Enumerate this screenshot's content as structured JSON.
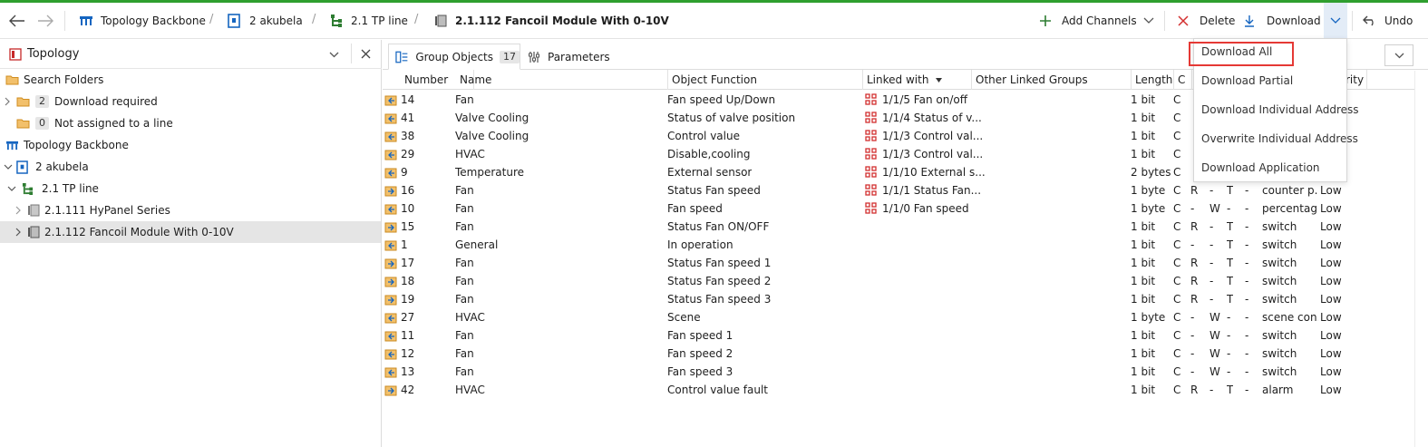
{
  "toolbar": {
    "breadcrumb": [
      {
        "label": "Topology Backbone",
        "icon": "topology-icon"
      },
      {
        "label": "2 akubela",
        "icon": "area-icon"
      },
      {
        "label": "2.1 TP line",
        "icon": "line-icon"
      },
      {
        "label": "2.1.112 Fancoil Module With 0-10V",
        "icon": "device-icon"
      }
    ],
    "add_channels": "Add Channels",
    "delete": "Delete",
    "download": "Download",
    "undo": "Undo"
  },
  "left_panel": {
    "title": "Topology",
    "tree": [
      {
        "label": "Search Folders",
        "icon": "folder-icon",
        "level": 0,
        "bold": false
      },
      {
        "label": "Download required",
        "badge": "2",
        "icon": "folder-icon",
        "level": 1,
        "expander": true
      },
      {
        "label": "Not assigned to a line",
        "badge": "0",
        "icon": "folder-icon",
        "level": 1
      },
      {
        "label": "Topology Backbone",
        "icon": "topology-icon",
        "level": 0
      },
      {
        "label": "2 akubela",
        "icon": "area-icon",
        "level": 1,
        "expanded": true
      },
      {
        "label": "2.1 TP line",
        "icon": "line-icon",
        "level": 2,
        "expanded": true
      },
      {
        "label": "2.1.111 HyPanel Series",
        "icon": "device-icon",
        "level": 3
      },
      {
        "label": "2.1.112 Fancoil Module With 0-10V",
        "icon": "device-icon",
        "level": 3,
        "selected": true
      }
    ]
  },
  "tabs": [
    {
      "label": "Group Objects",
      "count": "17",
      "active": true
    },
    {
      "label": "Parameters",
      "active": false
    }
  ],
  "table": {
    "columns": [
      "Number",
      "Name",
      "Object Function",
      "Linked with",
      "Other Linked Groups",
      "Length",
      "C",
      "",
      "",
      "",
      "",
      "",
      "rity"
    ],
    "rows": [
      {
        "num": "14",
        "name": "Fan",
        "func": "Fan speed Up/Down",
        "linked": "1/1/5 Fan on/off",
        "length": "1 bit",
        "c": "C",
        "r": "",
        "w": "",
        "t": "",
        "u": "",
        "dpt": "",
        "prio": ""
      },
      {
        "num": "41",
        "name": "Valve Cooling",
        "func": "Status of valve position",
        "linked": "1/1/4 Status of v...",
        "length": "1 bit",
        "c": "C",
        "r": "",
        "w": "",
        "t": "",
        "u": "",
        "dpt": "",
        "prio": ""
      },
      {
        "num": "38",
        "name": "Valve Cooling",
        "func": "Control value",
        "linked": "1/1/3 Control val...",
        "length": "1 bit",
        "c": "C",
        "r": "",
        "w": "",
        "t": "",
        "u": "",
        "dpt": "",
        "prio": ""
      },
      {
        "num": "29",
        "name": "HVAC",
        "func": "Disable,cooling",
        "linked": "1/1/3 Control val...",
        "length": "1 bit",
        "c": "C",
        "r": "",
        "w": "",
        "t": "",
        "u": "",
        "dpt": "",
        "prio": ""
      },
      {
        "num": "9",
        "name": "Temperature",
        "func": "External sensor",
        "linked": "1/1/10 External s...",
        "length": "2 bytes",
        "c": "C",
        "r": "",
        "w": "",
        "t": "",
        "u": "",
        "dpt": "",
        "prio": ""
      },
      {
        "num": "16",
        "name": "Fan",
        "func": "Status Fan speed",
        "linked": "1/1/1 Status Fan...",
        "length": "1 byte",
        "c": "C",
        "r": "R",
        "w": "-",
        "t": "T",
        "u": "-",
        "dpt": "counter p...",
        "prio": "Low"
      },
      {
        "num": "10",
        "name": "Fan",
        "func": "Fan speed",
        "linked": "1/1/0 Fan speed",
        "length": "1 byte",
        "c": "C",
        "r": "-",
        "w": "W",
        "t": "-",
        "u": "-",
        "dpt": "percentag...",
        "prio": "Low"
      },
      {
        "num": "15",
        "name": "Fan",
        "func": "Status Fan ON/OFF",
        "linked": "",
        "length": "1 bit",
        "c": "C",
        "r": "R",
        "w": "-",
        "t": "T",
        "u": "-",
        "dpt": "switch",
        "prio": "Low"
      },
      {
        "num": "1",
        "name": "General",
        "func": "In operation",
        "linked": "",
        "length": "1 bit",
        "c": "C",
        "r": "-",
        "w": "-",
        "t": "T",
        "u": "-",
        "dpt": "switch",
        "prio": "Low"
      },
      {
        "num": "17",
        "name": "Fan",
        "func": "Status Fan speed 1",
        "linked": "",
        "length": "1 bit",
        "c": "C",
        "r": "R",
        "w": "-",
        "t": "T",
        "u": "-",
        "dpt": "switch",
        "prio": "Low"
      },
      {
        "num": "18",
        "name": "Fan",
        "func": "Status Fan speed 2",
        "linked": "",
        "length": "1 bit",
        "c": "C",
        "r": "R",
        "w": "-",
        "t": "T",
        "u": "-",
        "dpt": "switch",
        "prio": "Low"
      },
      {
        "num": "19",
        "name": "Fan",
        "func": "Status Fan speed 3",
        "linked": "",
        "length": "1 bit",
        "c": "C",
        "r": "R",
        "w": "-",
        "t": "T",
        "u": "-",
        "dpt": "switch",
        "prio": "Low"
      },
      {
        "num": "27",
        "name": "HVAC",
        "func": "Scene",
        "linked": "",
        "length": "1 byte",
        "c": "C",
        "r": "-",
        "w": "W",
        "t": "-",
        "u": "-",
        "dpt": "scene con...",
        "prio": "Low"
      },
      {
        "num": "11",
        "name": "Fan",
        "func": "Fan speed 1",
        "linked": "",
        "length": "1 bit",
        "c": "C",
        "r": "-",
        "w": "W",
        "t": "-",
        "u": "-",
        "dpt": "switch",
        "prio": "Low"
      },
      {
        "num": "12",
        "name": "Fan",
        "func": "Fan speed 2",
        "linked": "",
        "length": "1 bit",
        "c": "C",
        "r": "-",
        "w": "W",
        "t": "-",
        "u": "-",
        "dpt": "switch",
        "prio": "Low"
      },
      {
        "num": "13",
        "name": "Fan",
        "func": "Fan speed 3",
        "linked": "",
        "length": "1 bit",
        "c": "C",
        "r": "-",
        "w": "W",
        "t": "-",
        "u": "-",
        "dpt": "switch",
        "prio": "Low"
      },
      {
        "num": "42",
        "name": "HVAC",
        "func": "Control value fault",
        "linked": "",
        "length": "1 bit",
        "c": "C",
        "r": "R",
        "w": "-",
        "t": "T",
        "u": "-",
        "dpt": "alarm",
        "prio": "Low"
      }
    ]
  },
  "download_menu": {
    "items": [
      "Download All",
      "Download Partial",
      "Download Individual Address",
      "Overwrite Individual Address",
      "Download Application"
    ],
    "highlighted": "Download All"
  },
  "colors": {
    "accent_green": "#2f9f2f",
    "folder": "#e6a93a",
    "link_red": "#d32f2f",
    "highlight_border": "#e53935",
    "blue_icon": "#1565c0"
  }
}
